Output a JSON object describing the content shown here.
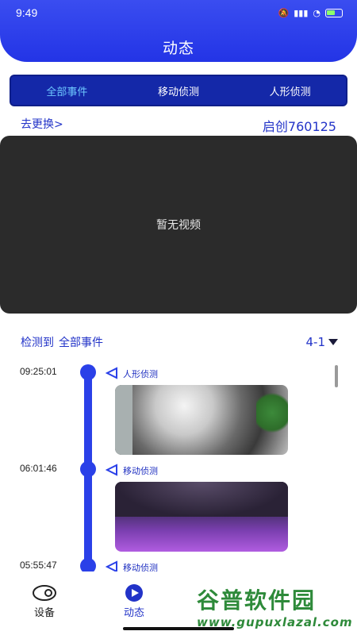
{
  "status": {
    "time": "9:49",
    "battery": "85"
  },
  "header": {
    "title": "动态"
  },
  "tabs": [
    {
      "label": "全部事件",
      "active": true
    },
    {
      "label": "移动侦测",
      "active": false
    },
    {
      "label": "人形侦测",
      "active": false
    }
  ],
  "device": {
    "switch_label": "去更换>",
    "name": "启创760125"
  },
  "video": {
    "empty_text": "暂无视频"
  },
  "filter": {
    "prefix": "检测到",
    "event_type": "全部事件",
    "date": "4-1"
  },
  "events": [
    {
      "time": "09:25:01",
      "type": "人形侦测"
    },
    {
      "time": "06:01:46",
      "type": "移动侦测"
    },
    {
      "time": "05:55:47",
      "type": "移动侦测"
    }
  ],
  "nav": [
    {
      "label": "设备",
      "icon": "camera-icon",
      "active": false
    },
    {
      "label": "动态",
      "icon": "play-icon",
      "active": true
    }
  ],
  "watermark": {
    "title": "谷普软件园",
    "url": "www.gupuxlazal.com"
  },
  "colors": {
    "accent": "#2a40e8",
    "tab_active": "#6ec8ff",
    "text_blue": "#2233c8"
  }
}
